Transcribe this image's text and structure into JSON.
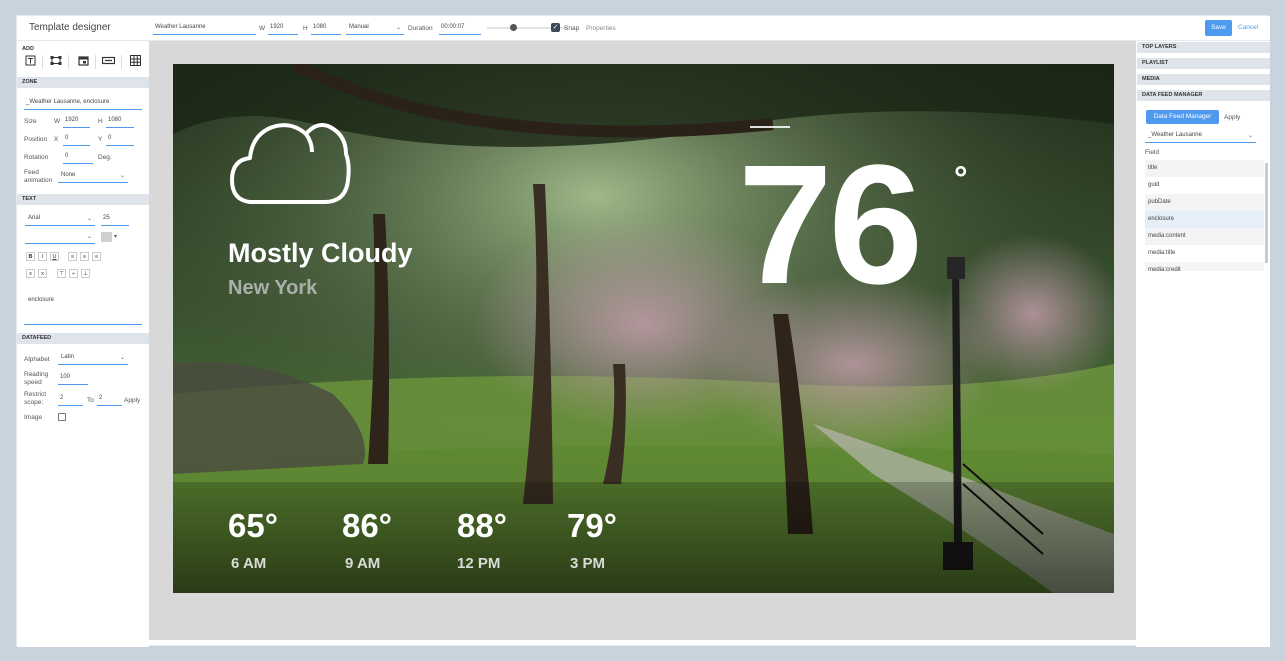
{
  "app": {
    "title": "Template designer"
  },
  "toolbar": {
    "name_value": "Weather Lausanne",
    "w_label": "W",
    "w_value": "1920",
    "h_label": "H",
    "h_value": "1080",
    "mode_value": "Manual",
    "duration_label": "Duration",
    "duration_value": "00:00:07",
    "snap_label": "Snap",
    "properties_label": "Properties",
    "save_label": "Save",
    "cancel_label": "Cancel"
  },
  "left": {
    "add_label": "ADD",
    "tools": [
      "text-tool-icon",
      "zone-tool-icon",
      "date-tool-icon",
      "ticker-tool-icon",
      "table-tool-icon"
    ],
    "zone": {
      "header": "ZONE",
      "name_value": "_Weather Lausanne, enclosure",
      "size_label": "Size",
      "w_label": "W",
      "w_value": "1920",
      "h_label": "H",
      "h_value": "1080",
      "position_label": "Position",
      "x_label": "X",
      "x_value": "0",
      "y_label": "Y",
      "y_value": "0",
      "rotation_label": "Rotation",
      "rotation_value": "0",
      "deg_label": "Deg.",
      "feed_animation_label": "Feed\nanimation",
      "feed_animation_value": "None"
    },
    "text": {
      "header": "TEXT",
      "font_value": "Arial",
      "size_value": "25",
      "format_buttons": [
        "B",
        "I",
        "U"
      ],
      "content_value": "enclosure"
    },
    "datafeed": {
      "header": "DATAFEED",
      "alphabet_label": "Alphabet",
      "alphabet_value": "Latin",
      "reading_speed_label": "Reading\nspeed",
      "reading_speed_value": "100",
      "restrict_label": "Restrict\nscope:",
      "restrict_from": "2",
      "to_label": "To",
      "restrict_to": "2",
      "apply_label": "Apply",
      "image_label": "Image"
    }
  },
  "canvas": {
    "condition": "Mostly Cloudy",
    "city": "New York",
    "temperature": "76",
    "degree": "°",
    "forecast": [
      {
        "temp": "65°",
        "time": "6 AM"
      },
      {
        "temp": "86°",
        "time": "9 AM"
      },
      {
        "temp": "88°",
        "time": "12 PM"
      },
      {
        "temp": "79°",
        "time": "3 PM"
      }
    ]
  },
  "right": {
    "sections": [
      "TOP LAYERS",
      "PLAYLIST",
      "MEDIA",
      "DATA FEED MANAGER"
    ],
    "dfm_button": "Data Feed Manager",
    "apply_label": "Apply",
    "feed_value": "_Weather Lausanne",
    "field_label": "Field",
    "fields": [
      "title",
      "guid",
      "pubDate",
      "enclosure",
      "media:content",
      "media:title",
      "media:credit"
    ]
  },
  "colors": {
    "accent": "#4e9af1",
    "panel_header": "#dfe4ea"
  }
}
